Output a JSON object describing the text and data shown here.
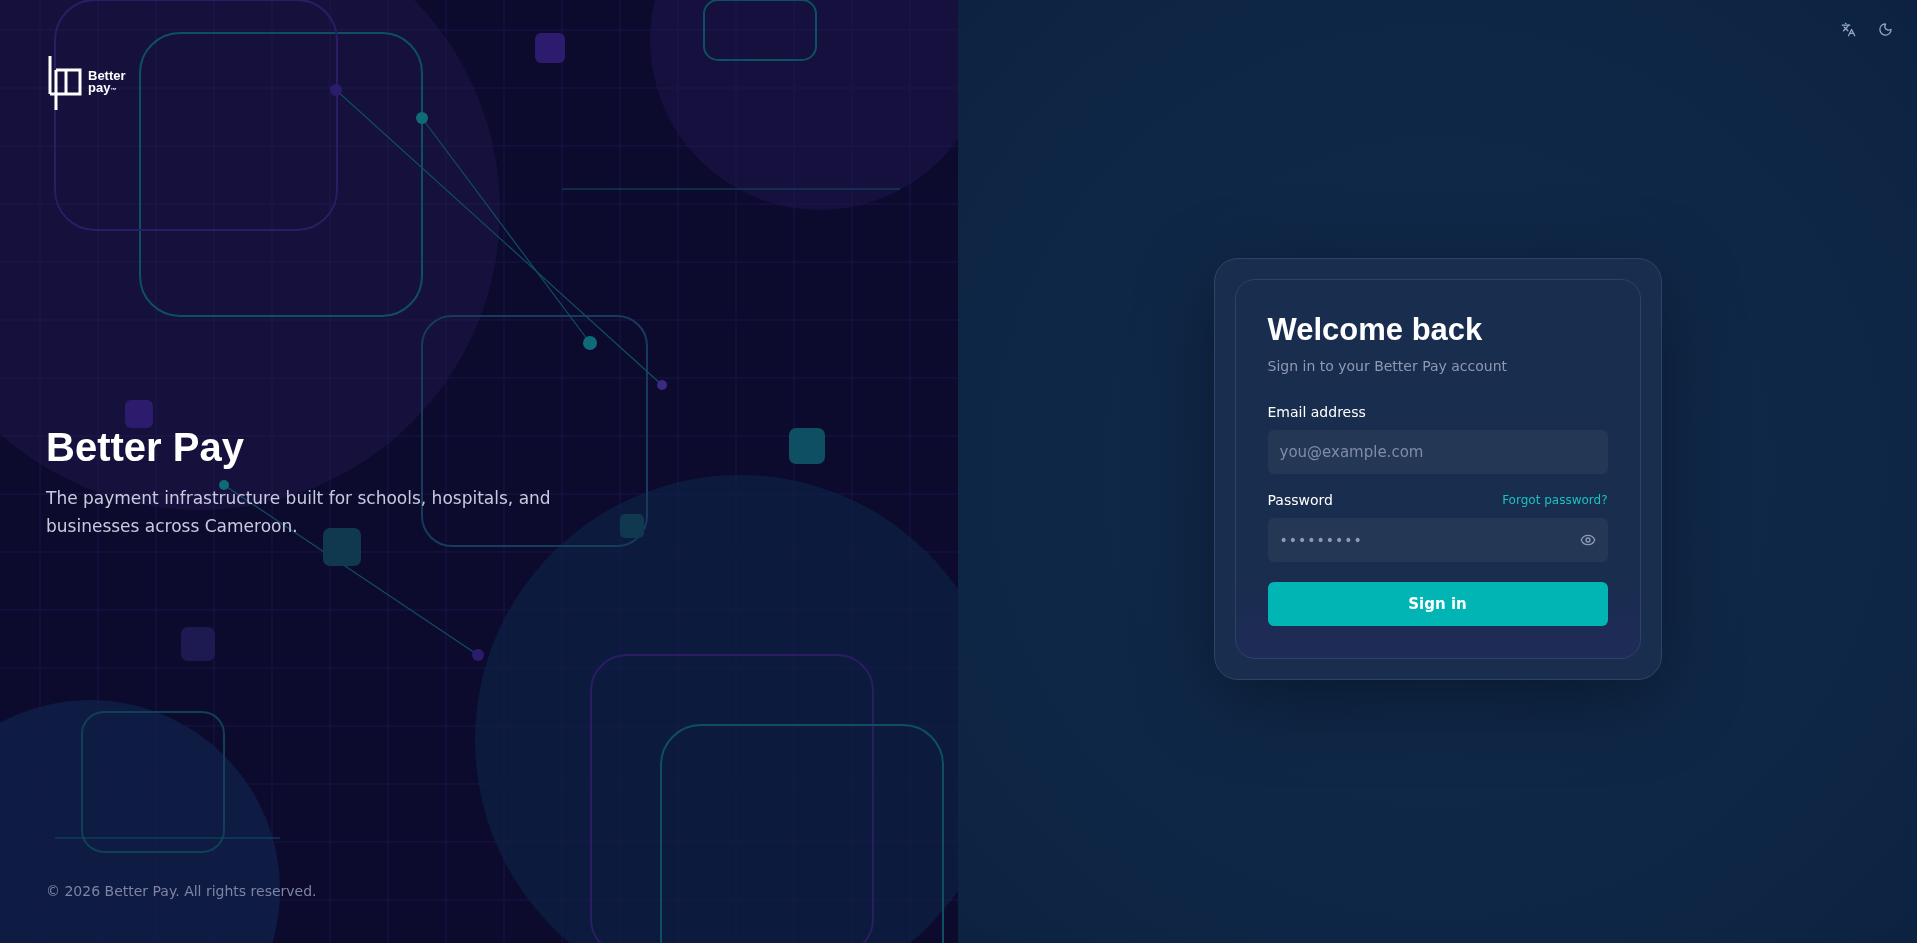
{
  "brand_panel": {
    "logo": {
      "wordmark_top": "Better",
      "wordmark_bottom": "pay",
      "trademark": "™"
    },
    "title": "Better Pay",
    "tagline": "The payment infrastructure built for schools, hospitals, and businesses across Cameroon.",
    "footer": "© 2026 Better Pay. All rights reserved."
  },
  "toolbar": {
    "buttons": [
      {
        "kind": "language"
      },
      {
        "kind": "theme"
      }
    ]
  },
  "login_card": {
    "title": "Welcome back",
    "subtitle": "Sign in to your Better Pay account",
    "email": {
      "label": "Email address",
      "placeholder": "you@example.com"
    },
    "password": {
      "label": "Password",
      "value": "•••••••••",
      "forgot_link": "Forgot password?"
    },
    "submit": "Sign in"
  }
}
